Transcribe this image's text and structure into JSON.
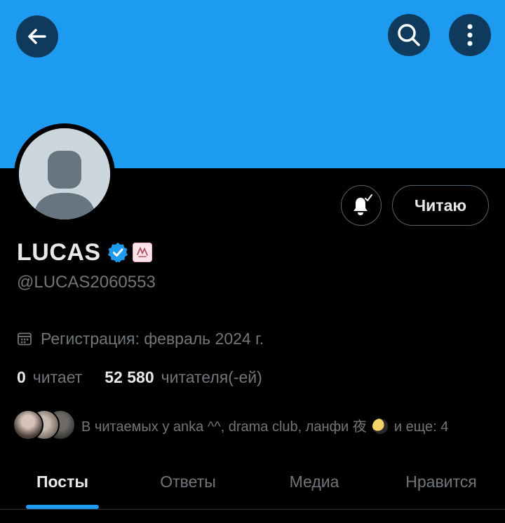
{
  "colors": {
    "banner": "#1d9bf0",
    "accent": "#1d9bf0",
    "background": "#000000",
    "text_primary": "#e7e9ea",
    "text_secondary": "#71767b"
  },
  "header": {
    "back_icon": "arrow-left-icon",
    "search_icon": "search-icon",
    "more_icon": "more-vertical-icon"
  },
  "profile": {
    "name": "LUCAS",
    "verified_icon": "verified-badge-icon",
    "emoji_badge_icon": "emoji-badge-icon",
    "handle": "@LUCAS2060553",
    "notifications_icon": "bell-check-icon",
    "follow_label": "Читаю",
    "registration": "Регистрация: февраль 2024 г.",
    "calendar_icon": "calendar-icon"
  },
  "stats": {
    "following_count": "0",
    "following_label": "читает",
    "followers_count": "52 580",
    "followers_label": "читателя(-ей)"
  },
  "followed_by": {
    "text_before": "В читаемых у anka ^^, drama club, ланфи 夜",
    "moon_icon": "moon-emoji-icon",
    "text_after": "и еще: 4"
  },
  "tabs": [
    {
      "label": "Посты",
      "active": true
    },
    {
      "label": "Ответы",
      "active": false
    },
    {
      "label": "Медиа",
      "active": false
    },
    {
      "label": "Нравится",
      "active": false
    }
  ]
}
